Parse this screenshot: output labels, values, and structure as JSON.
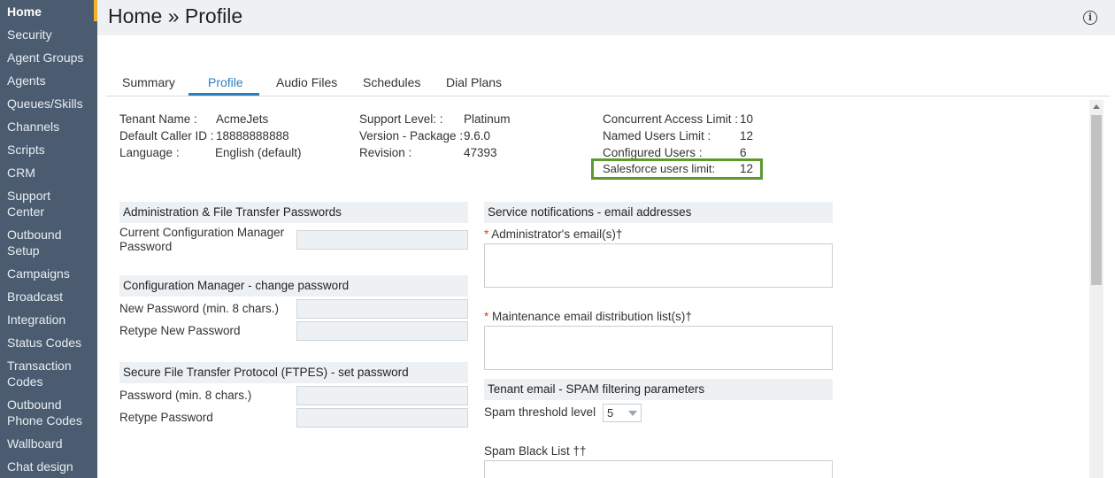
{
  "sidebar": {
    "items": [
      {
        "label": "Home"
      },
      {
        "label": "Security"
      },
      {
        "label": "Agent Groups"
      },
      {
        "label": "Agents"
      },
      {
        "label": "Queues/Skills"
      },
      {
        "label": "Channels"
      },
      {
        "label": "Scripts"
      },
      {
        "label": "CRM"
      },
      {
        "label": "Support",
        "label2": "Center"
      },
      {
        "label": "Outbound",
        "label2": "Setup"
      },
      {
        "label": "Campaigns"
      },
      {
        "label": "Broadcast"
      },
      {
        "label": "Integration"
      },
      {
        "label": "Status Codes"
      },
      {
        "label": "Transaction",
        "label2": "Codes"
      },
      {
        "label": "Outbound",
        "label2": "Phone Codes"
      },
      {
        "label": "Wallboard"
      },
      {
        "label": "Chat design"
      }
    ]
  },
  "header": {
    "title": "Home » Profile",
    "info_icon": "i"
  },
  "tabs": [
    "Summary",
    "Profile",
    "Audio Files",
    "Schedules",
    "Dial Plans"
  ],
  "info": {
    "tenant_name_label": "Tenant Name :",
    "tenant_name": "AcmeJets",
    "caller_id_label": "Default Caller ID :",
    "caller_id": "18888888888",
    "language_label": "Language :",
    "language": "English (default)",
    "support_level_label": "Support Level: :",
    "support_level": "Platinum",
    "version_label": "Version - Package :",
    "version": "9.6.0",
    "revision_label": "Revision :",
    "revision": "47393",
    "concurrent_label": "Concurrent Access Limit :",
    "concurrent": "10",
    "named_users_label": "Named Users Limit :",
    "named_users": "12",
    "configured_users_label": "Configured Users :",
    "configured_users": "6",
    "salesforce_label": "Salesforce users limit:",
    "salesforce": "12"
  },
  "admin_passwords": {
    "title": "Administration & File Transfer Passwords",
    "current_label_1": "Current Configuration Manager",
    "current_label_2": "Password"
  },
  "config_manager": {
    "title": "Configuration Manager - change password",
    "new_label": "New Password (min. 8 chars.)",
    "retype_label": "Retype New Password"
  },
  "ftpes": {
    "title": "Secure File Transfer Protocol (FTPES) - set password",
    "password_label": "Password (min. 8 chars.)",
    "retype_label": "Retype Password"
  },
  "notifications": {
    "title": "Service notifications - email addresses",
    "admin_email_label": "Administrator's email(s)†",
    "maintenance_label": "Maintenance email distribution list(s)†",
    "required_mark": "*"
  },
  "spam": {
    "title": "Tenant email - SPAM filtering parameters",
    "threshold_label": "Spam threshold level",
    "threshold_value": "5",
    "blacklist_label": "Spam Black List ††"
  }
}
